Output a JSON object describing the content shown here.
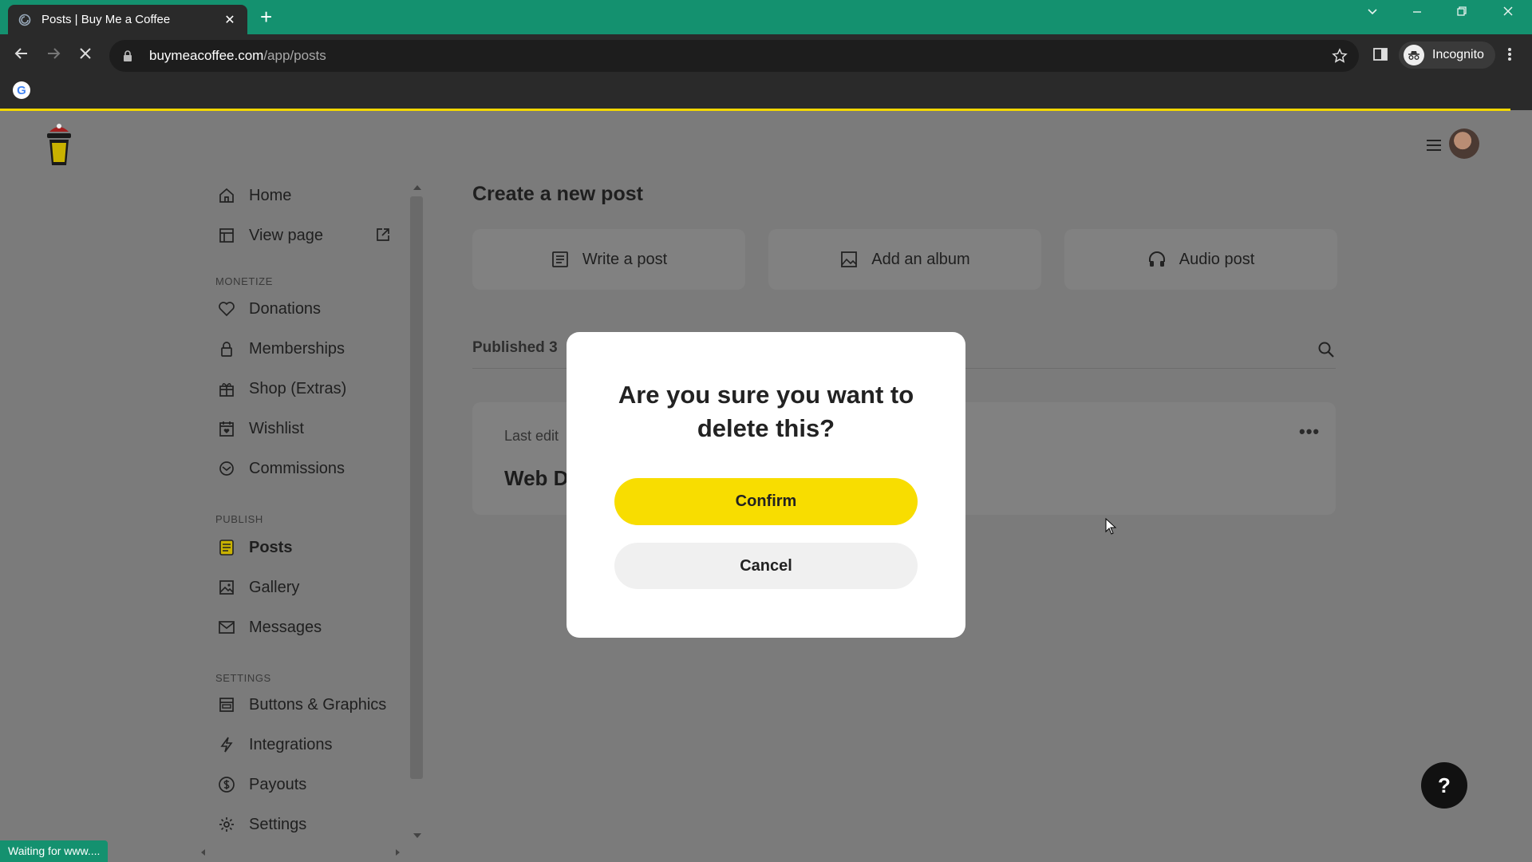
{
  "browser": {
    "tab_title": "Posts | Buy Me a Coffee",
    "tab_close": "✕",
    "new_tab": "+",
    "url_host": "buymeacoffee.com",
    "url_path": "/app/posts",
    "profile_label": "Incognito",
    "status_text": "Waiting for www....",
    "accent_color": "#14916f"
  },
  "sidebar": {
    "items_top": [
      {
        "label": "Home",
        "icon": "home-icon"
      },
      {
        "label": "View page",
        "icon": "layout-icon"
      }
    ],
    "monetize_header": "MONETIZE",
    "monetize": [
      {
        "label": "Donations",
        "icon": "heart-icon"
      },
      {
        "label": "Memberships",
        "icon": "lock-icon"
      },
      {
        "label": "Shop (Extras)",
        "icon": "gift-icon"
      },
      {
        "label": "Wishlist",
        "icon": "calendar-icon"
      },
      {
        "label": "Commissions",
        "icon": "commission-icon"
      }
    ],
    "publish_header": "PUBLISH",
    "publish": [
      {
        "label": "Posts",
        "icon": "document-icon",
        "active": true
      },
      {
        "label": "Gallery",
        "icon": "image-icon"
      },
      {
        "label": "Messages",
        "icon": "mail-icon"
      }
    ],
    "settings_header": "SETTINGS",
    "settings": [
      {
        "label": "Buttons & Graphics",
        "icon": "buttons-icon"
      },
      {
        "label": "Integrations",
        "icon": "bolt-icon"
      },
      {
        "label": "Payouts",
        "icon": "dollar-icon"
      },
      {
        "label": "Settings",
        "icon": "gear-icon"
      }
    ]
  },
  "main": {
    "title": "Create a new post",
    "create_options": [
      {
        "label": "Write a post",
        "icon": "document-icon"
      },
      {
        "label": "Add an album",
        "icon": "image-icon"
      },
      {
        "label": "Audio post",
        "icon": "headphones-icon"
      }
    ],
    "published_label": "Published 3",
    "post": {
      "meta": "Last edit",
      "title": "Web D",
      "more": "•••"
    },
    "help": "?"
  },
  "modal": {
    "question": "Are you sure you want to delete this?",
    "confirm_label": "Confirm",
    "cancel_label": "Cancel",
    "confirm_color": "#f8dd00"
  }
}
